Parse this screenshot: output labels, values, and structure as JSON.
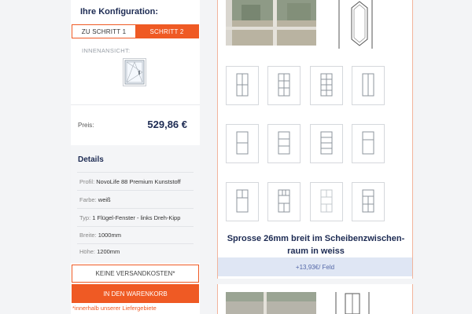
{
  "config": {
    "title": "Ihre Konfiguration:",
    "steps": [
      {
        "label": "ZU SCHRITT 1",
        "active": false
      },
      {
        "label": "SCHRITT 2",
        "active": true
      }
    ],
    "inner_view_label": "INNENANSICHT:",
    "price_label": "Preis:",
    "price_value": "529,86 €"
  },
  "details": {
    "title": "Details",
    "rows": [
      {
        "key": "Profil:",
        "value": "NovoLife 88 Premium Kunststoff"
      },
      {
        "key": "Farbe:",
        "value": "weiß"
      },
      {
        "key": "Typ:",
        "value": "1 Flügel-Fenster - links Dreh-Kipp"
      },
      {
        "key": "Breite:",
        "value": "1000mm"
      },
      {
        "key": "Höhe:",
        "value": "1200mm"
      }
    ]
  },
  "actions": {
    "shipping_label": "KEINE VERSANDKOSTEN*",
    "cart_label": "IN DEN WARENKORB",
    "footnote": "*innerhalb unserer Liefergebiete"
  },
  "product": {
    "caption": "Sprosse 26mm breit im Scheibenzwischen-raum in weiss",
    "price_note": "+13,93€/ Feld"
  },
  "colors": {
    "accent": "#ef5a24",
    "navy": "#1d2b53",
    "price_bar": "#dfe6f4"
  }
}
